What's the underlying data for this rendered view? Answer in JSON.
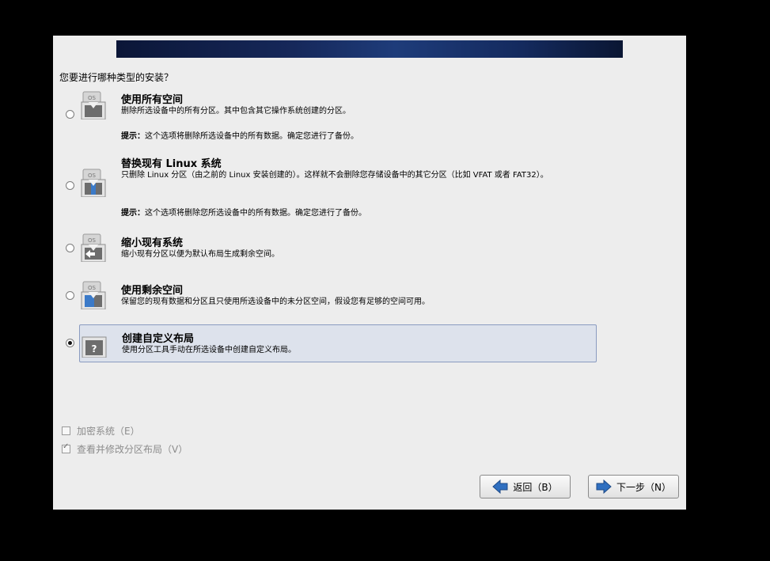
{
  "installer": {
    "question": "您要进行哪种类型的安装？",
    "options": [
      {
        "title": "使用所有空间",
        "description": "删除所选设备中的所有分区。其中包含其它操作系统创建的分区。",
        "hint_label": "提示：",
        "hint": "这个选项将删除所选设备中的所有数据。确定您进行了备份。",
        "icon": "disk-erase-icon",
        "selected": false
      },
      {
        "title": "替换现有 Linux 系统",
        "description": "只删除 Linux 分区（由之前的 Linux 安装创建的）。这样就不会删除您存储设备中的其它分区（比如 VFAT 或者 FAT32）。",
        "hint_label": "提示：",
        "hint": "这个选项将删除您所选设备中的所有数据。确定您进行了备份。",
        "icon": "disk-replace-icon",
        "selected": false
      },
      {
        "title": "缩小现有系统",
        "description": "缩小现有分区以便为默认布局生成剩余空间。",
        "icon": "disk-shrink-icon",
        "selected": false
      },
      {
        "title": "使用剩余空间",
        "description": "保留您的现有数据和分区且只使用所选设备中的未分区空间，假设您有足够的空间可用。",
        "icon": "disk-free-space-icon",
        "selected": false
      },
      {
        "title": "创建自定义布局",
        "description": "使用分区工具手动在所选设备中创建自定义布局。",
        "icon": "disk-custom-icon",
        "selected": true
      }
    ],
    "os_badge": "OS",
    "custom_glyph": "?",
    "checkboxes": [
      {
        "label": "加密系统（E）",
        "checked": false,
        "enabled": false
      },
      {
        "label": "查看并修改分区布局（V）",
        "checked": true,
        "enabled": false
      }
    ],
    "buttons": {
      "back": "返回（B）",
      "next": "下一步（N）"
    },
    "colors": {
      "panel_bg": "#ededed",
      "selected_bg": "#dde2ec",
      "arrow_blue": "#2f6fc0"
    }
  }
}
